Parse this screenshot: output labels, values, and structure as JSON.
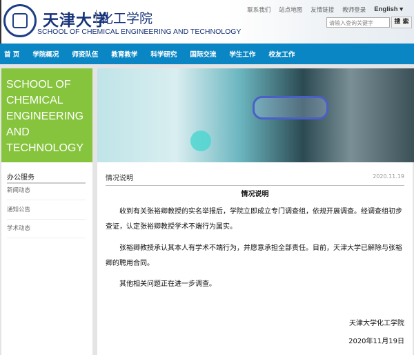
{
  "header": {
    "university_cn": "天津大学",
    "college_cn": "化工学院",
    "school_en": "SCHOOL OF CHEMICAL ENGINEERING AND TECHNOLOGY",
    "top_links": [
      "联系我们",
      "站点地图",
      "友情链接",
      "教师登录"
    ],
    "language": "English ▾",
    "search_placeholder": "请输入查询关键字",
    "search_button": "搜 索"
  },
  "nav": [
    "首 页",
    "学院概况",
    "师资队伍",
    "教育教学",
    "科学研究",
    "国际交流",
    "学生工作",
    "校友工作"
  ],
  "banner": {
    "lines": [
      "SCHOOL OF",
      "CHEMICAL",
      "ENGINEERING",
      "AND",
      "TECHNOLOGY"
    ]
  },
  "sidebar": {
    "title": "办公服务",
    "items": [
      "新闻动态",
      "通知公告",
      "学术动态"
    ]
  },
  "article": {
    "section": "情况说明",
    "date": "2020.11.19",
    "title": "情况说明",
    "paragraphs": [
      "收到有关张裕卿教授的实名举报后，学院立即成立专门调查组，依规开展调查。经调查组初步查证，认定张裕卿教授学术不端行为属实。",
      "张裕卿教授承认其本人有学术不端行为，并愿意承担全部责任。目前，天津大学已解除与张裕卿的聘用合同。",
      "其他相关问题正在进一步调查。"
    ],
    "signature": "天津大学化工学院",
    "sign_date": "2020年11月19日"
  },
  "colors": {
    "nav": "#0a86c4",
    "green": "#86c43d",
    "brand": "#17337a"
  }
}
